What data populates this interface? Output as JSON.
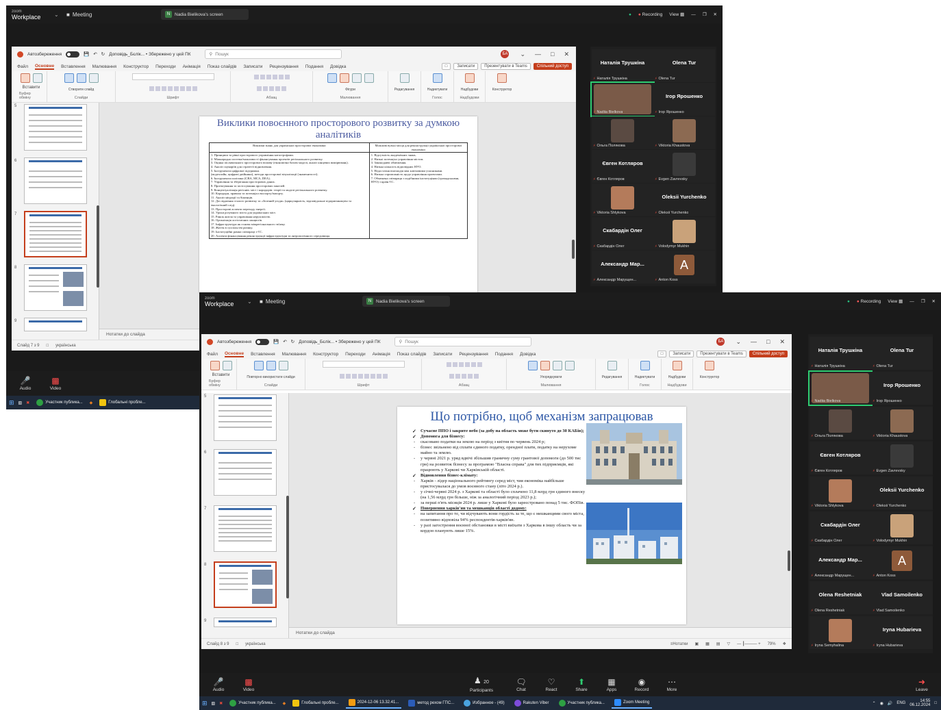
{
  "zoom": {
    "logo_small": "zoom",
    "logo_big": "Workplace",
    "meeting_label": "Meeting",
    "screen_share_label": "Nadia Bielikova's screen",
    "recording_label": "Recording",
    "view_label": "View"
  },
  "ppt": {
    "autosave_label": "Автозбереження",
    "doc_title": "Доповідь_Бєлік... • Збережено у цей ПК",
    "search_placeholder": "Пошук",
    "avatar_initials": "БА",
    "tabs": [
      "Файл",
      "Основне",
      "Вставлення",
      "Малювання",
      "Конструктор",
      "Переходи",
      "Анімація",
      "Показ слайдів",
      "Записати",
      "Рецензування",
      "Подання",
      "Довідка"
    ],
    "tab_buttons": [
      "Записати",
      "Презентувати в Teams",
      "Спільний доступ"
    ],
    "ribbon_groups": [
      "Буфер обміну",
      "Слайди",
      "Шрифт",
      "Абзац",
      "Малювання",
      "Голос",
      "Надбудови"
    ],
    "ribbon_buttons": [
      "Вставити",
      "Створити слайд",
      "Повторно використати слайди",
      "Фігури",
      "Упорядкувати",
      "Експрес-стилі",
      "Редагування",
      "Надиктувати",
      "Надбудови",
      "Конструктор"
    ],
    "notes_label": "Нотатки до слайда"
  },
  "shotA": {
    "thumb_numbers": [
      "5",
      "6",
      "7",
      "8",
      "9"
    ],
    "status_slide": "Слайд 7 з 9",
    "status_lang": "українська",
    "slide_title": "Виклики повоєнного просторового розвитку за думкою аналітиків",
    "table_headers": [
      "Виклики знань для української просторової економіки",
      "Можливі вузькі місця для реконструкції української просторової економіки"
    ],
    "table_left": "1. Принципи та рівні просторового управління катастрофами.\n2. Міжнародна система/можливості фінансування проектів регіонального розвитку.\n3. Оцінка післявоєнного просторового впливу (економічні базові моделі, аналіз кінцевих вимірювань).\n4. Аналіз сценаріїв для стратегії відновлення.\n5. Інструменти цифрової підтримки.\n(моделлайн, цифрові двійники), методи просторової візуалізації (знаменитості).\n6. Інструменти політики (CBA, MCA, DEA).\n7. Управління та зберігання просторових даних.\n8. Проектування та застосування просторових панелей.\n9. Концептуалізація регіонів: міст і коридорів: теорії та моделі регіонального розвитку.\n10. Коридори, правила та потенціал експорту/імпорту.\n11. Аналіз міграції та біженців.\n12. Дослідження сталого розвитку та «Зелений угоди» (циркулярність, відповідальне підприємництво та екологічний слід).\n13. Просторові аспекти переходу енергії.\n14. Уроки розумного міста для українських міст.\n15. Ринок житла та управління нерухомістю.\n16. Організація логістичних ланцюгів.\n17. Інфраструктура як основа міжрегіонального зв'язку.\n18. Життя в суспільстві ризику.\n19. Інституційні рамки співпраці з ЄС.\n20. Аспекти фінансування реконструкції інфраструктури та антропогенного середовища.",
    "table_right": "1. Відсутність академічних знань.\n2. Низькі потенціал управління містом.\n3. Законодавчі обмеження.\n4. Низька кількість відповідних НУО.\n5. Недостатня взаємодія між ключовими учасниками.\n6. Низька спроможність щодо управління проектами.\n7. Обмежена співпраця з подібними інституціями (громадськими, НУО) з країн ЄС."
  },
  "shotB": {
    "thumb_numbers": [
      "5",
      "6",
      "7",
      "8",
      "9"
    ],
    "status_slide": "Слайд 8 з 9",
    "status_lang": "українська",
    "status_notes": "Нотатки",
    "status_zoom": "79%",
    "slide_title": "Що потрібно, щоб механізм запрацював",
    "bullets": [
      {
        "kind": "chk",
        "text": "Сучасне ППО і закрите небо (за добу на область може бути скинуто до 30 КАБів);"
      },
      {
        "kind": "chk",
        "text": "Допомога для бізнесу:"
      },
      {
        "kind": "dash",
        "text": "скасовано податки на землю на період з квітня по червень 2024 р;"
      },
      {
        "kind": "dash",
        "text": "бізнес звільнено від сплати єдиного податку, орендної плати, податку на нерухоме майно та землю."
      },
      {
        "kind": "dash",
        "text": "у червні 2021 р. уряд вдвічі збільшив граничну суму грантової допомоги (до 500 тис грн) на розвиток бізнесу за програмою \"Власна справа\" для тих підприємців, які працюють у Харкові чи Харківській області."
      },
      {
        "kind": "chk",
        "text": "Відновлення бізнес-клімату:"
      },
      {
        "kind": "dash",
        "text": "Харків - лідер національного рейтингу серед міст, чия економіка найбільше пристосувалася до умов воєнного стану (літо 2024 р.)."
      },
      {
        "kind": "dash",
        "text": "у січні-червні 2024 р. з Харкові та області було сплачено 11,8 млрд грн єдиного внеску (на 1,56 млрд грн більше, ніж за аналогічний період 2023 р.);"
      },
      {
        "kind": "dash",
        "text": "за перші п'ять місяців 2024 р. лише у Харкові було зареєстровано понад 5 тис. ФОПів."
      },
      {
        "kind": "chk",
        "text": "Повернення харків'ян та мешканців області додому:"
      },
      {
        "kind": "dash",
        "text": "на запитання про те, чи відчувають вони гордість за те, що є мешканцями свого міста, позитивно відповіла 94% респондентів-харків'ян."
      },
      {
        "kind": "dash",
        "text": "у разі загострення воєнної обстановки в місті виїхати з Харкова в іншу область чи за кордон планують лише 15%."
      }
    ]
  },
  "gallery": {
    "tiles": [
      {
        "name": "Наталія Трушкіна",
        "label": "Наталія Трушкіна"
      },
      {
        "name": "Olena Tur",
        "label": "Olena Tur"
      },
      {
        "name": "",
        "label": "Nadiia Bielkova"
      },
      {
        "name": "Ігор Ярошенко",
        "label": "Ігор Ярошенко"
      },
      {
        "name": "",
        "label": "Ольга Полякова"
      },
      {
        "name": "",
        "label": "Viktoria Khaustova"
      },
      {
        "name": "Євген Котляров",
        "label": "Євген Котляров"
      },
      {
        "name": "",
        "label": "Evgen Zavrevsky"
      },
      {
        "name": "",
        "label": "Viktoria Shlykova"
      },
      {
        "name": "Oleksii Yurchenko",
        "label": "Oleksii Yurchenko"
      },
      {
        "name": "Скабардін Олег",
        "label": "Скабардін Олег"
      },
      {
        "name": "",
        "label": "Volodymyr Mukhin"
      },
      {
        "name": "Александр Мар...",
        "label": "Александр Марущен..."
      },
      {
        "name": "",
        "label": "Anton Koss",
        "letter": "A"
      },
      {
        "name": "Olena Reshetniak",
        "label": "Olena Reshetniak"
      },
      {
        "name": "Vlad Samoilenko",
        "label": "Vlad Samoilenko"
      },
      {
        "name": "",
        "label": "Iryna Semyhalina"
      },
      {
        "name": "Iryna Hubarieva",
        "label": "Iryna Hubarieva"
      }
    ]
  },
  "zoom_toolbar": {
    "audio": "Audio",
    "video": "Video",
    "participants": "Participants",
    "participants_count": "20",
    "chat": "Chat",
    "react": "React",
    "share": "Share",
    "apps": "Apps",
    "record": "Record",
    "more": "More",
    "leave": "Leave"
  },
  "taskbar": {
    "items_a": [
      "Участник публика...",
      "Глобальні пробле..."
    ],
    "items_b": [
      "Участник публика...",
      "Глобальні пробле...",
      "2024-12-06 13.32.41...",
      "метод рехом ГПС...",
      "Избранное - (49)",
      "Rakuten Viber",
      "Участник публика...",
      "Zoom Meeting"
    ],
    "lang": "ENG",
    "time": "14:55",
    "date": "06.12.2024"
  }
}
